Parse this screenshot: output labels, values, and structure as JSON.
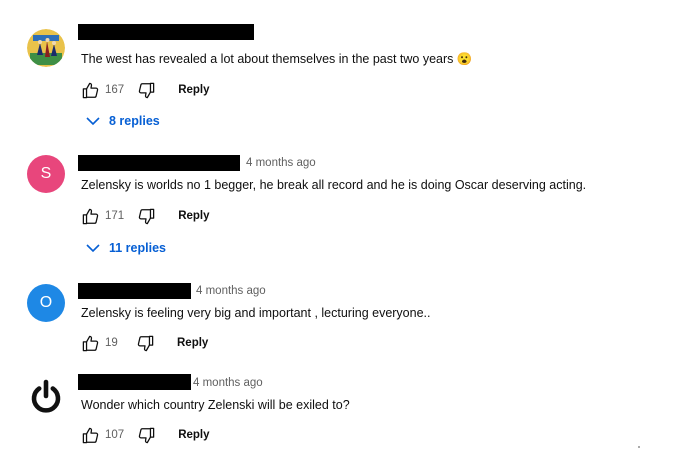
{
  "comments": [
    {
      "avatar_letter": "",
      "avatar_kind": "image",
      "timestamp": "",
      "text": "The west has revealed a lot about themselves in the past two years 😮",
      "likes": "167",
      "reply_label": "Reply",
      "replies_label": "8 replies"
    },
    {
      "avatar_letter": "S",
      "avatar_color": "#e8467c",
      "timestamp": "4 months ago",
      "text": "Zelensky is worlds no 1 begger, he break all record and he is doing Oscar deserving acting.",
      "likes": "171",
      "reply_label": "Reply",
      "replies_label": "11 replies"
    },
    {
      "avatar_letter": "O",
      "avatar_color": "#1e88e5",
      "timestamp": "4 months ago",
      "text": "Zelensky is feeling very big and important , lecturing everyone..",
      "likes": "19",
      "reply_label": "Reply"
    },
    {
      "avatar_kind": "power-icon",
      "timestamp": "4 months ago",
      "text": "Wonder which country Zelenski will be exiled to?",
      "likes": "107",
      "reply_label": "Reply"
    }
  ]
}
